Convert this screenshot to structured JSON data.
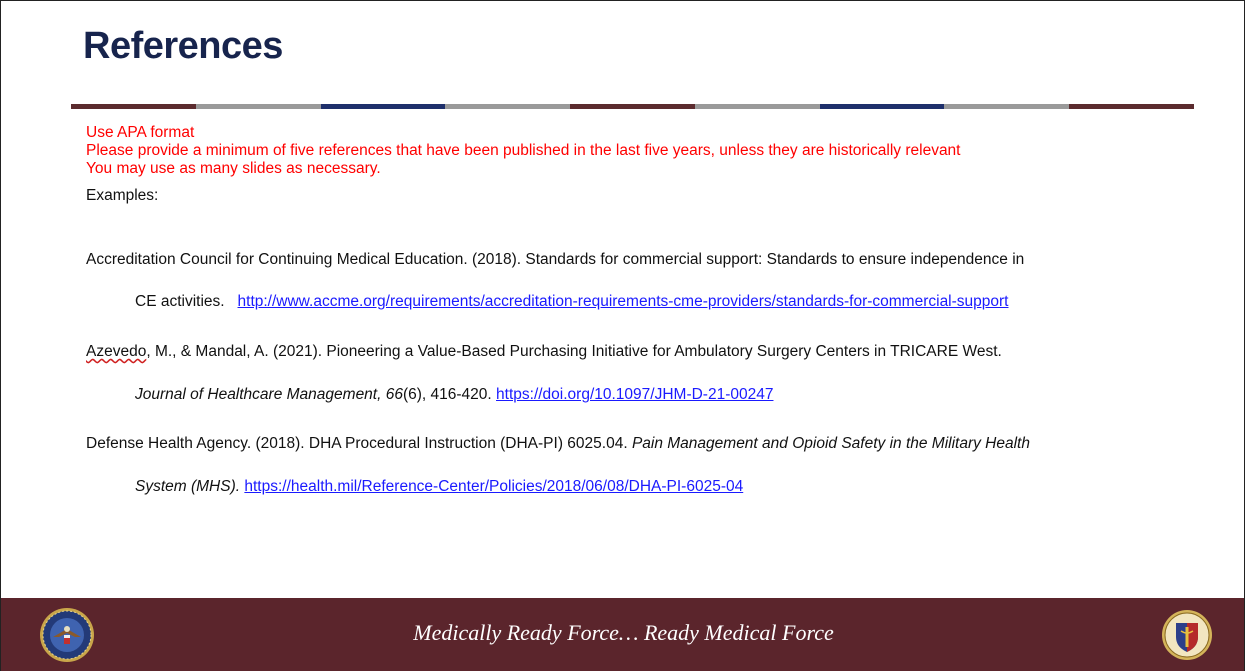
{
  "slide": {
    "title": "References",
    "divider_colors": [
      "#5b2b2e",
      "#9a9a9a",
      "#1e2f6b",
      "#9a9a9a",
      "#5b2b2e",
      "#9a9a9a",
      "#1e2f6b",
      "#9a9a9a",
      "#5b2b2e"
    ],
    "instructions": [
      "Use APA format",
      "Please provide a minimum of five references that have been published in the last five years, unless they are historically relevant",
      "You may use as many slides as necessary."
    ],
    "instructions_color": "#ff0000",
    "examples_label": "Examples:",
    "references": [
      {
        "line1": "Accreditation Council for Continuing Medical Education. (2018). Standards for commercial support: Standards to ensure independence in",
        "line2_text": "CE activities.",
        "line2_link": "http://www.accme.org/requirements/accreditation-requirements-cme-providers/standards-for-commercial-support"
      },
      {
        "author_squiggle": "Azevedo",
        "line1_rest": ", M., & Mandal, A. (2021). Pioneering a Value-Based Purchasing Initiative for Ambulatory Surgery Centers in TRICARE West.",
        "line2_italic": "Journal of Healthcare Management, 66",
        "line2_text": "(6), 416-420.",
        "line2_link": "https://doi.org/10.1097/JHM-D-21-00247"
      },
      {
        "line1_text": "Defense Health Agency. (2018). DHA Procedural Instruction (DHA-PI) 6025.04.",
        "line1_italic": "Pain Management and Opioid Safety in the Military Health",
        "line2_italic": "System (MHS).",
        "line2_link": "https://health.mil/Reference-Center/Policies/2018/06/08/DHA-PI-6025-04"
      }
    ]
  },
  "footer": {
    "tagline": "Medically Ready Force… Ready Medical Force",
    "background": "#5b252c",
    "left_seal": "dod-seal-icon",
    "right_seal": "defense-health-agency-seal-icon"
  }
}
